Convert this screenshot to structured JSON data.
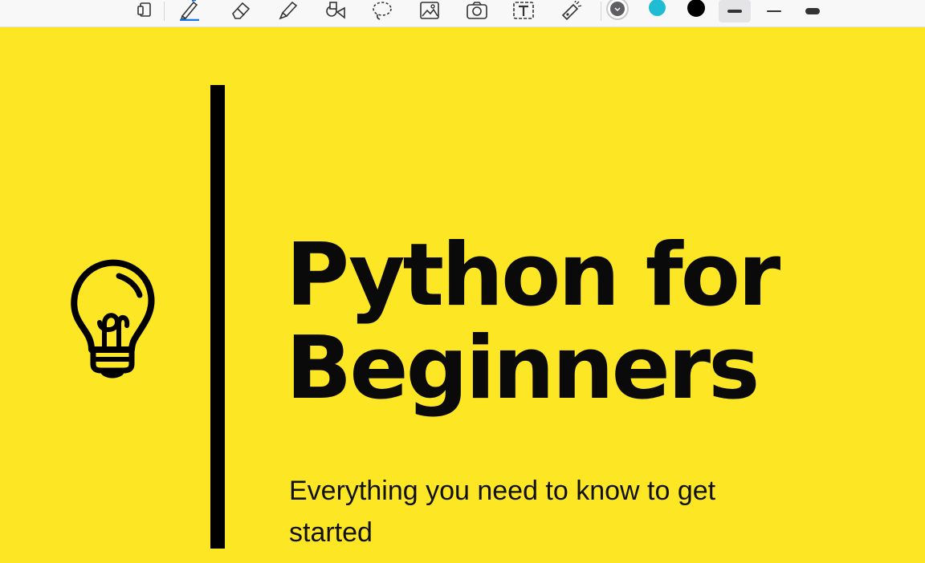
{
  "toolbar": {
    "tools": [
      {
        "name": "page-layout-tool",
        "icon": "page-layout-icon"
      },
      {
        "name": "pen-tool",
        "icon": "pen-icon",
        "selected": true
      },
      {
        "name": "eraser-tool",
        "icon": "eraser-icon"
      },
      {
        "name": "highlighter-tool",
        "icon": "highlighter-icon"
      },
      {
        "name": "shapes-tool",
        "icon": "shapes-icon"
      },
      {
        "name": "lasso-tool",
        "icon": "lasso-icon"
      },
      {
        "name": "image-tool",
        "icon": "image-icon"
      },
      {
        "name": "camera-tool",
        "icon": "camera-icon"
      },
      {
        "name": "text-tool",
        "icon": "text-box-icon"
      },
      {
        "name": "laser-pointer-tool",
        "icon": "laser-pointer-icon"
      }
    ],
    "colors": [
      {
        "name": "color-gray",
        "hex": "#5f5f63",
        "selected": true
      },
      {
        "name": "color-cyan",
        "hex": "#1fbcd3"
      },
      {
        "name": "color-black",
        "hex": "#000000"
      }
    ],
    "stroke_widths": [
      {
        "name": "stroke-medium",
        "selected": true
      },
      {
        "name": "stroke-thin"
      },
      {
        "name": "stroke-thick"
      }
    ]
  },
  "slide": {
    "background": "#fde725",
    "icon": "lightbulb-icon",
    "title_line1": "Python for",
    "title_line2": "Beginners",
    "subtitle": "Everything you need to know to get started"
  }
}
